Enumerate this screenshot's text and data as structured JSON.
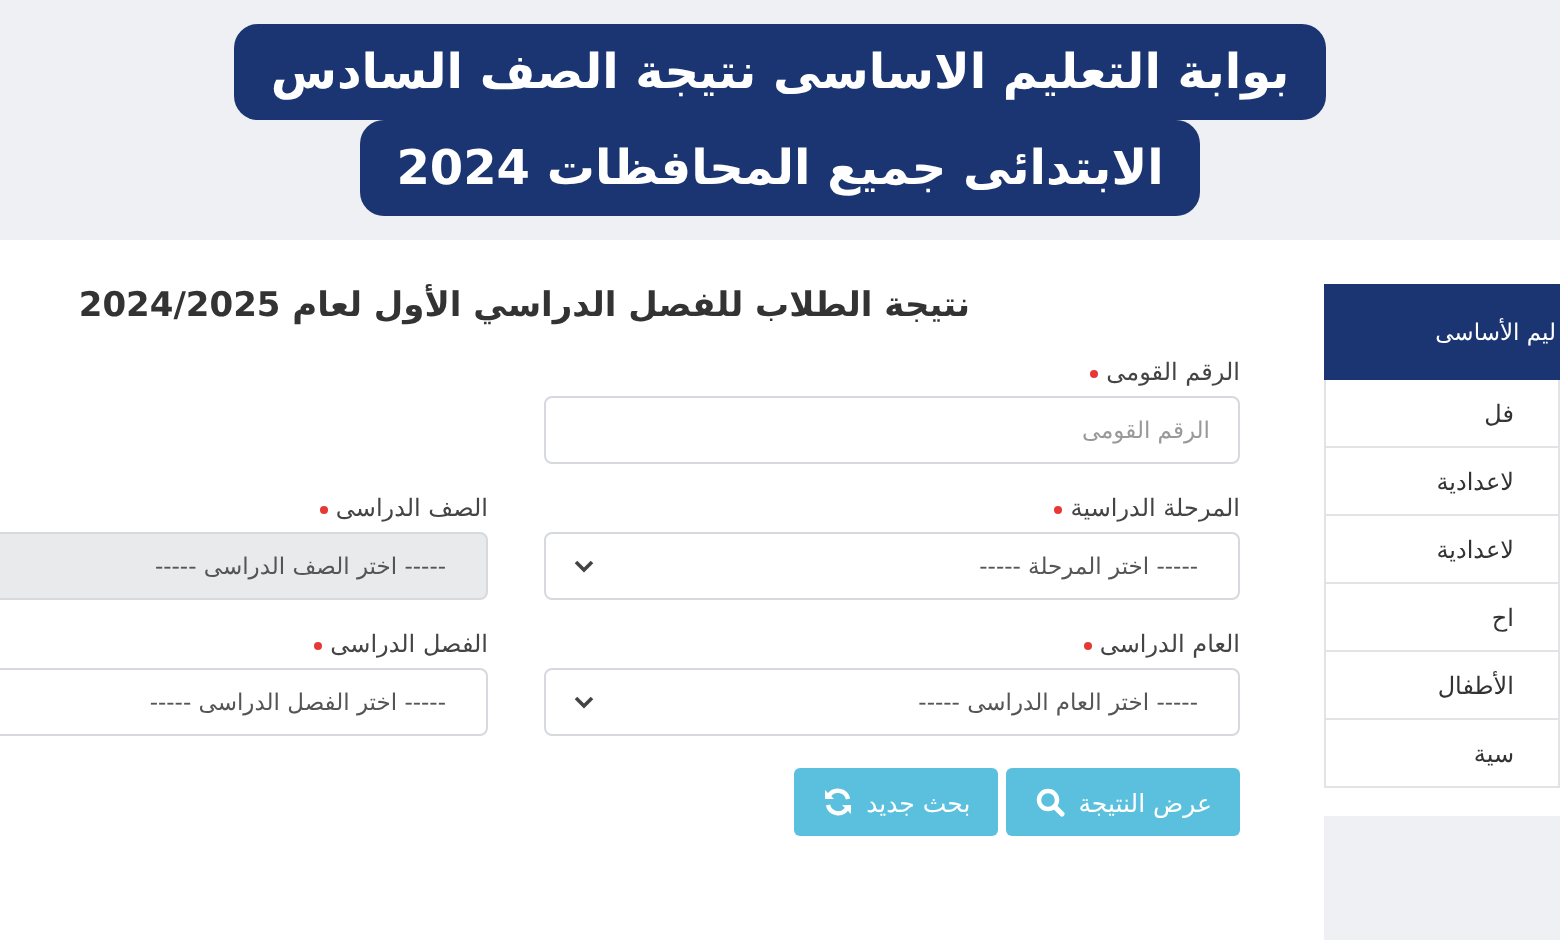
{
  "banner": {
    "title_lines": [
      "بوابة التعليم الاساسى نتيجة الصف السادس",
      "الابتدائى جميع المحافظات 2024"
    ]
  },
  "form": {
    "title": "نتيجة الطلاب للفصل الدراسي  الأول  لعام  2024/2025",
    "rows": [
      [
        {
          "kind": "input",
          "label": "الرقم القومى",
          "required": true,
          "placeholder": "الرقم القومى",
          "disabled": false
        }
      ],
      [
        {
          "kind": "select",
          "label": "المرحلة الدراسية",
          "required": true,
          "value": "----- اختر المرحلة -----",
          "disabled": false
        },
        {
          "kind": "select",
          "label": "الصف الدراسى",
          "required": true,
          "value": "----- اختر الصف الدراسى -----",
          "disabled": true
        }
      ],
      [
        {
          "kind": "select",
          "label": "العام الدراسى",
          "required": true,
          "value": "----- اختر العام الدراسى -----",
          "disabled": false
        },
        {
          "kind": "select",
          "label": "الفصل الدراسى",
          "required": true,
          "value": "----- اختر الفصل الدراسى -----",
          "disabled": false
        }
      ]
    ],
    "buttons": [
      "عرض النتيجة",
      "بحث جديد"
    ]
  },
  "sidebar": {
    "header": "ليم الأساسى",
    "items": [
      "فل",
      "لاعدادية",
      "لاعدادية",
      "اح",
      "الأطفال",
      "سية"
    ]
  }
}
